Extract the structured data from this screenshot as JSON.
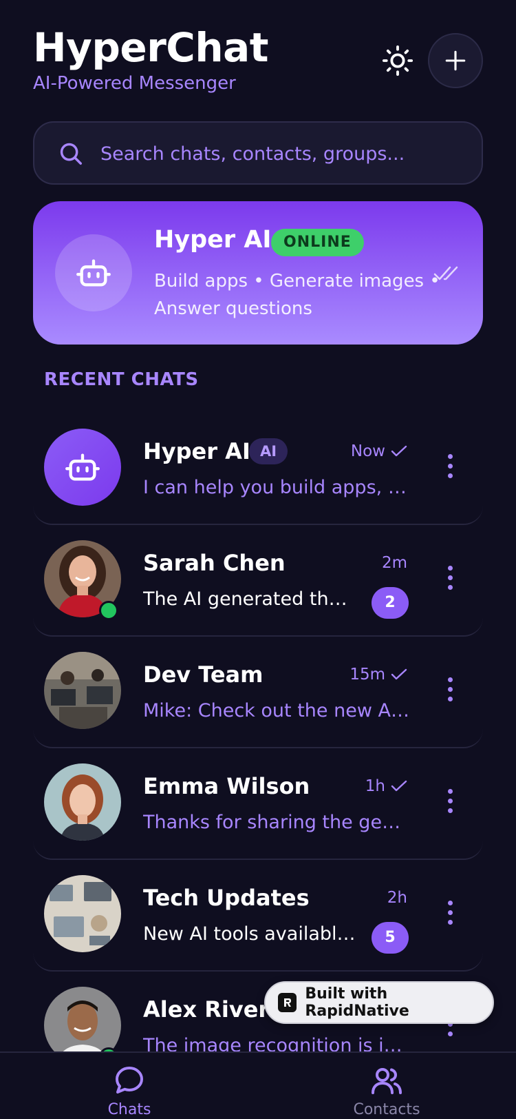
{
  "header": {
    "title": "HyperChat",
    "subtitle": "AI-Powered Messenger",
    "theme_icon": "sun-icon",
    "add_icon": "plus-icon"
  },
  "search": {
    "placeholder": "Search chats, contacts, groups..."
  },
  "ai_card": {
    "name": "Hyper AI",
    "status": "ONLINE",
    "description": "Build apps • Generate images • Answer questions",
    "icon": "robot-icon",
    "read_icon": "double-check-icon"
  },
  "section_label": "RECENT CHATS",
  "chats": [
    {
      "name": "Hyper AI",
      "tag": "AI",
      "time": "Now",
      "read": true,
      "preview": "I can help you build apps, g...",
      "unread": null,
      "online": false
    },
    {
      "name": "Sarah Chen",
      "time": "2m",
      "read": false,
      "preview": "The AI generated the ...",
      "unread": "2",
      "online": true
    },
    {
      "name": "Dev Team",
      "time": "15m",
      "read": true,
      "preview": "Mike: Check out the new AI ...",
      "unread": null,
      "online": false
    },
    {
      "name": "Emma Wilson",
      "time": "1h",
      "read": true,
      "preview": "Thanks for sharing the gene...",
      "unread": null,
      "online": false
    },
    {
      "name": "Tech Updates",
      "time": "2h",
      "read": false,
      "preview": "New AI tools available ...",
      "unread": "5",
      "online": false
    },
    {
      "name": "Alex Rivera",
      "time": "",
      "read": false,
      "preview": "The image recognition is inc...",
      "unread": null,
      "online": true
    }
  ],
  "bottom_nav": {
    "chats": "Chats",
    "contacts": "Contacts"
  },
  "built_with": "Built with RapidNative",
  "colors": {
    "background": "#0f0e20",
    "accent": "#a886ff",
    "primary": "#8b5cf6",
    "online": "#22c55e"
  }
}
